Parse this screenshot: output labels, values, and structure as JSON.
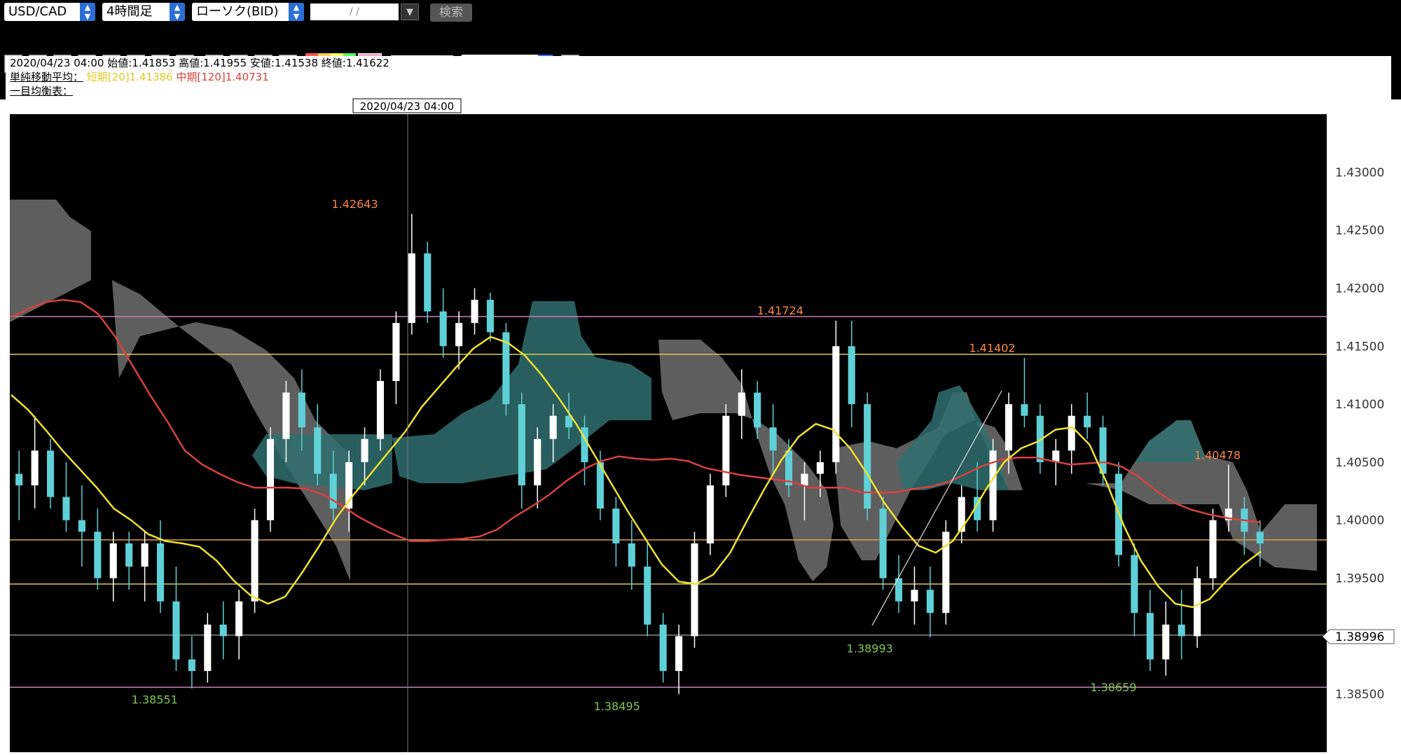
{
  "toolbar": {
    "pair": "USD/CAD",
    "timeframe": "4時間足",
    "chart_type": "ローソク(BID)",
    "date_placeholder": "/ /",
    "search_label": "検索",
    "line_width": "1",
    "line_style": "通常線"
  },
  "info": {
    "ohlc": "2020/04/23 04:00 始値:1.41853 高値:1.41955 安値:1.41538 終値:1.41622",
    "sma_label": "単純移動平均：",
    "sma_short": "短期[20]1.41386",
    "sma_mid": "中期[120]1.40731",
    "ichimoku_label": "一目均衡表："
  },
  "colors": {
    "sma_short": "#f0e130",
    "sma_mid": "#d9413f",
    "kumo_bull": "#2f6f6f",
    "kumo_bear": "#6e6e6e",
    "bull_candle": "#ffffff",
    "bear_candle": "#5fd0d8",
    "high_label": "#ff8844",
    "low_label": "#7ec850"
  },
  "chart_data": {
    "type": "candlestick",
    "cursor_time": "2020/04/23 04:00",
    "ylim": [
      1.38,
      1.435
    ],
    "y_ticks": [
      "1.43000",
      "1.42500",
      "1.42000",
      "1.41500",
      "1.41000",
      "1.40500",
      "1.40000",
      "1.39500",
      "1.39000",
      "1.38500"
    ],
    "current_price": "1.38996",
    "annotations": [
      {
        "text": "1.42643",
        "type": "high",
        "xfrac": 0.262,
        "value": 1.42643
      },
      {
        "text": "1.41724",
        "type": "high",
        "xfrac": 0.585,
        "value": 1.41724
      },
      {
        "text": "1.41402",
        "type": "high",
        "xfrac": 0.746,
        "value": 1.41402
      },
      {
        "text": "1.40478",
        "type": "high",
        "xfrac": 0.917,
        "value": 1.40478
      },
      {
        "text": "1.38551",
        "type": "low",
        "xfrac": 0.11,
        "value": 1.38551
      },
      {
        "text": "1.38495",
        "type": "low",
        "xfrac": 0.461,
        "value": 1.38495
      },
      {
        "text": "1.38993",
        "type": "low",
        "xfrac": 0.653,
        "value": 1.38993
      },
      {
        "text": "1.38659",
        "type": "low",
        "xfrac": 0.838,
        "value": 1.38659
      }
    ],
    "hlines": [
      {
        "value": 1.41755,
        "color": "#c77fb2"
      },
      {
        "value": 1.4143,
        "color": "#d9c95a"
      },
      {
        "value": 1.3983,
        "color": "#e0a040"
      },
      {
        "value": 1.3945,
        "color": "#d9c95a"
      },
      {
        "value": 1.3901,
        "color": "#888888"
      },
      {
        "value": 1.3856,
        "color": "#c77fb2"
      }
    ],
    "sma_short": [
      1.4108,
      1.4095,
      1.4078,
      1.406,
      1.4044,
      1.4028,
      1.401,
      1.4,
      1.3988,
      1.3982,
      1.398,
      1.3977,
      1.3965,
      1.3948,
      1.3935,
      1.3928,
      1.3934,
      1.3955,
      1.3978,
      1.4002,
      1.4022,
      1.404,
      1.4058,
      1.4076,
      1.4098,
      1.4115,
      1.4132,
      1.4148,
      1.4158,
      1.4153,
      1.4142,
      1.4125,
      1.4105,
      1.4083,
      1.4058,
      1.4033,
      1.4008,
      1.3985,
      1.3962,
      1.3947,
      1.3945,
      1.3953,
      1.3972,
      1.4,
      1.4027,
      1.4052,
      1.4072,
      1.4083,
      1.4078,
      1.4062,
      1.404,
      1.4015,
      1.3995,
      1.3978,
      1.3972,
      1.3982,
      1.4003,
      1.4028,
      1.405,
      1.4062,
      1.4068,
      1.4078,
      1.408,
      1.4065,
      1.4032,
      1.3995,
      1.3965,
      1.3943,
      1.3928,
      1.3925,
      1.3932,
      1.3948,
      1.3962,
      1.3973
    ],
    "sma_mid": [
      1.4175,
      1.4182,
      1.4188,
      1.419,
      1.4188,
      1.4178,
      1.4158,
      1.4133,
      1.4108,
      1.4085,
      1.406,
      1.4048,
      1.404,
      1.4033,
      1.4028,
      1.4028,
      1.4028,
      1.4027,
      1.4022,
      1.4013,
      1.4003,
      1.3995,
      1.3988,
      1.3982,
      1.3982,
      1.3983,
      1.3984,
      1.3986,
      1.3992,
      1.4003,
      1.4012,
      1.4022,
      1.4034,
      1.4044,
      1.4051,
      1.4055,
      1.4053,
      1.4052,
      1.4053,
      1.4051,
      1.4045,
      1.4042,
      1.4039,
      1.4037,
      1.4035,
      1.4033,
      1.4028,
      1.4028,
      1.4028,
      1.4024,
      1.4024,
      1.4024,
      1.4027,
      1.4029,
      1.4033,
      1.404,
      1.4047,
      1.4052,
      1.4054,
      1.4054,
      1.4051,
      1.4048,
      1.4049,
      1.405,
      1.4046,
      1.4037,
      1.4025,
      1.4015,
      1.4009,
      1.4005,
      1.4002,
      1.4,
      1.3998
    ],
    "candles": [
      [
        1.404,
        1.406,
        1.4,
        1.403
      ],
      [
        1.403,
        1.409,
        1.401,
        1.406
      ],
      [
        1.406,
        1.407,
        1.401,
        1.402
      ],
      [
        1.402,
        1.405,
        1.399,
        1.4
      ],
      [
        1.4,
        1.403,
        1.396,
        1.399
      ],
      [
        1.399,
        1.401,
        1.394,
        1.395
      ],
      [
        1.395,
        1.399,
        1.393,
        1.398
      ],
      [
        1.398,
        1.399,
        1.394,
        1.396
      ],
      [
        1.396,
        1.399,
        1.393,
        1.398
      ],
      [
        1.398,
        1.4,
        1.392,
        1.393
      ],
      [
        1.393,
        1.396,
        1.387,
        1.388
      ],
      [
        1.388,
        1.39,
        1.3855,
        1.387
      ],
      [
        1.387,
        1.392,
        1.386,
        1.391
      ],
      [
        1.391,
        1.393,
        1.388,
        1.39
      ],
      [
        1.39,
        1.394,
        1.388,
        1.393
      ],
      [
        1.393,
        1.401,
        1.392,
        1.4
      ],
      [
        1.4,
        1.408,
        1.399,
        1.407
      ],
      [
        1.407,
        1.412,
        1.405,
        1.411
      ],
      [
        1.411,
        1.413,
        1.406,
        1.408
      ],
      [
        1.408,
        1.41,
        1.403,
        1.404
      ],
      [
        1.404,
        1.406,
        1.4,
        1.401
      ],
      [
        1.401,
        1.406,
        1.399,
        1.405
      ],
      [
        1.405,
        1.408,
        1.403,
        1.407
      ],
      [
        1.407,
        1.413,
        1.406,
        1.412
      ],
      [
        1.412,
        1.418,
        1.41,
        1.417
      ],
      [
        1.417,
        1.4264,
        1.416,
        1.423
      ],
      [
        1.423,
        1.424,
        1.417,
        1.418
      ],
      [
        1.418,
        1.42,
        1.414,
        1.415
      ],
      [
        1.415,
        1.418,
        1.413,
        1.417
      ],
      [
        1.417,
        1.42,
        1.416,
        1.419
      ],
      [
        1.419,
        1.4196,
        1.4154,
        1.4162
      ],
      [
        1.4162,
        1.417,
        1.409,
        1.41
      ],
      [
        1.41,
        1.411,
        1.401,
        1.403
      ],
      [
        1.403,
        1.408,
        1.401,
        1.407
      ],
      [
        1.407,
        1.41,
        1.405,
        1.409
      ],
      [
        1.409,
        1.411,
        1.407,
        1.408
      ],
      [
        1.408,
        1.409,
        1.403,
        1.405
      ],
      [
        1.405,
        1.406,
        1.4,
        1.401
      ],
      [
        1.401,
        1.402,
        1.396,
        1.398
      ],
      [
        1.398,
        1.4,
        1.394,
        1.396
      ],
      [
        1.396,
        1.398,
        1.39,
        1.391
      ],
      [
        1.391,
        1.392,
        1.386,
        1.387
      ],
      [
        1.387,
        1.391,
        1.385,
        1.39
      ],
      [
        1.39,
        1.399,
        1.389,
        1.398
      ],
      [
        1.398,
        1.404,
        1.397,
        1.403
      ],
      [
        1.403,
        1.41,
        1.402,
        1.409
      ],
      [
        1.409,
        1.413,
        1.407,
        1.411
      ],
      [
        1.411,
        1.412,
        1.407,
        1.408
      ],
      [
        1.408,
        1.41,
        1.404,
        1.406
      ],
      [
        1.406,
        1.407,
        1.402,
        1.403
      ],
      [
        1.403,
        1.405,
        1.4,
        1.404
      ],
      [
        1.404,
        1.406,
        1.402,
        1.405
      ],
      [
        1.405,
        1.4172,
        1.404,
        1.415
      ],
      [
        1.415,
        1.4172,
        1.408,
        1.41
      ],
      [
        1.41,
        1.411,
        1.4,
        1.401
      ],
      [
        1.401,
        1.402,
        1.394,
        1.395
      ],
      [
        1.395,
        1.397,
        1.392,
        1.393
      ],
      [
        1.393,
        1.396,
        1.391,
        1.394
      ],
      [
        1.394,
        1.396,
        1.3899,
        1.392
      ],
      [
        1.392,
        1.4,
        1.391,
        1.399
      ],
      [
        1.399,
        1.403,
        1.398,
        1.402
      ],
      [
        1.402,
        1.405,
        1.399,
        1.4
      ],
      [
        1.4,
        1.407,
        1.399,
        1.406
      ],
      [
        1.406,
        1.411,
        1.404,
        1.41
      ],
      [
        1.41,
        1.414,
        1.408,
        1.409
      ],
      [
        1.409,
        1.41,
        1.404,
        1.405
      ],
      [
        1.405,
        1.407,
        1.403,
        1.406
      ],
      [
        1.406,
        1.41,
        1.404,
        1.409
      ],
      [
        1.409,
        1.411,
        1.407,
        1.408
      ],
      [
        1.408,
        1.409,
        1.403,
        1.404
      ],
      [
        1.404,
        1.405,
        1.396,
        1.397
      ],
      [
        1.397,
        1.398,
        1.39,
        1.392
      ],
      [
        1.392,
        1.394,
        1.387,
        1.388
      ],
      [
        1.388,
        1.393,
        1.3866,
        1.391
      ],
      [
        1.391,
        1.394,
        1.388,
        1.39
      ],
      [
        1.39,
        1.396,
        1.389,
        1.395
      ],
      [
        1.395,
        1.401,
        1.394,
        1.4
      ],
      [
        1.4,
        1.4048,
        1.399,
        1.401
      ],
      [
        1.401,
        1.402,
        1.397,
        1.399
      ],
      [
        1.399,
        1.4,
        1.396,
        1.398
      ]
    ]
  }
}
